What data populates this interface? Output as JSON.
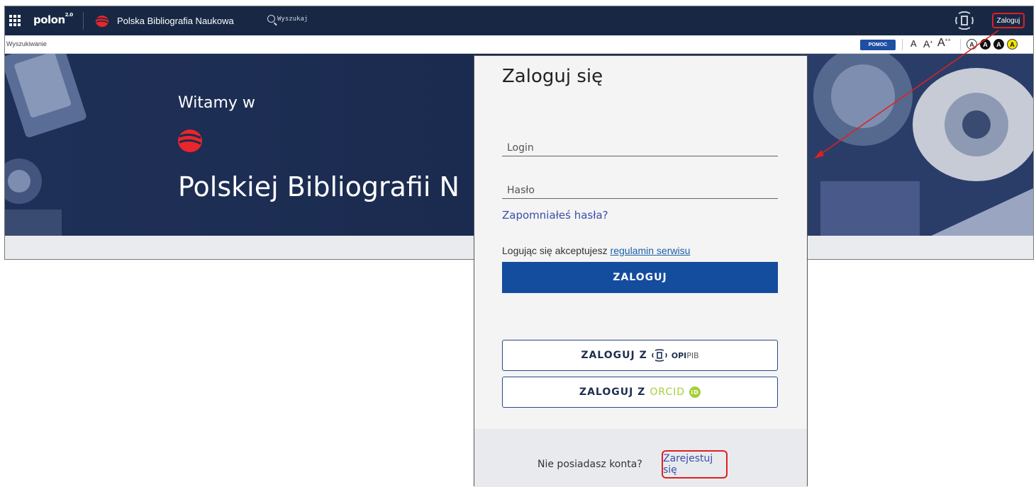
{
  "topbar": {
    "brand": "polon",
    "brand_version": "2.0",
    "app_name": "Polska Bibliografia Naukowa",
    "search_placeholder": "Wyszukaj",
    "login_label": "Zaloguj"
  },
  "subbar": {
    "breadcrumb": "Wyszukiwanie",
    "help_label": "POMOC",
    "font_small": "A",
    "font_medium": "A",
    "font_large": "A",
    "font_medium_sup": "+",
    "font_large_sup": "++",
    "contrast_options": [
      "A",
      "A",
      "A",
      "A"
    ]
  },
  "hero": {
    "welcome": "Witamy w",
    "title": "Polskiej Bibliografii N"
  },
  "login_panel": {
    "title": "Zaloguj się",
    "login_placeholder": "Login",
    "password_placeholder": "Hasło",
    "forgot_password": "Zapomniałeś hasła?",
    "terms_prefix": "Logując się akceptujesz",
    "terms_link": "regulamin serwisu",
    "submit_label": "ZALOGUJ",
    "opi_button_prefix": "ZALOGUJ Z",
    "opi_word_bold": "OPI",
    "opi_word_light": "PIB",
    "orcid_button_prefix": "ZALOGUJ Z",
    "orcid_word": "ORCID",
    "orcid_icon_text": "iD",
    "no_account": "Nie posiadasz konta?",
    "register_link": "Zarejestuj się"
  },
  "colors": {
    "topbar_bg": "#182844",
    "primary_button": "#144c9e",
    "annotation_red": "#e02020",
    "orcid_green": "#a6ce39",
    "link_blue": "#3a4fa8"
  }
}
